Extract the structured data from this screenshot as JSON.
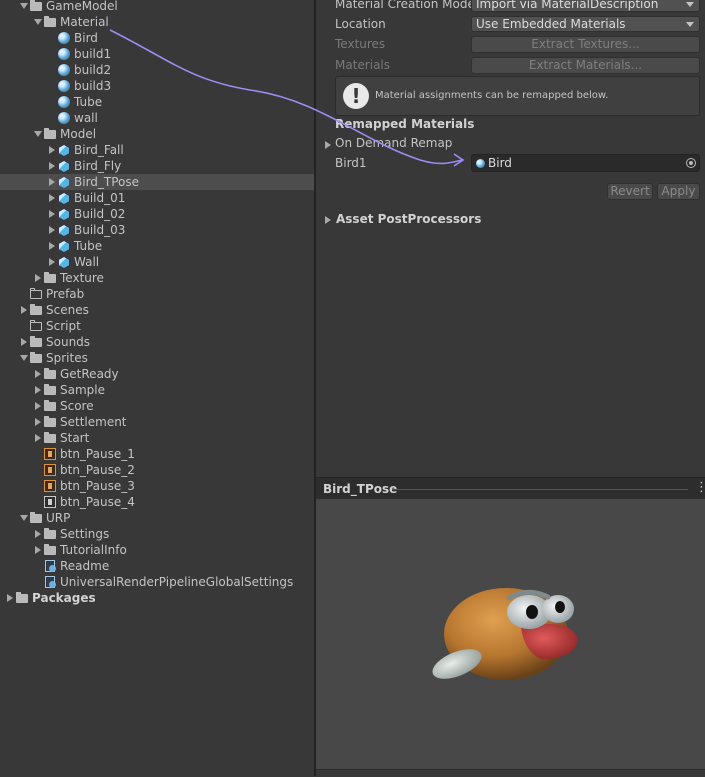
{
  "project_tree": [
    {
      "label": "GameModel",
      "indent": 1,
      "fold": "open",
      "icon": "folder-icon",
      "kind": "folder filled"
    },
    {
      "label": "Material",
      "indent": 2,
      "fold": "open",
      "icon": "folder-icon",
      "kind": "folder filled"
    },
    {
      "label": "Bird",
      "indent": 3,
      "fold": "",
      "icon": "material-icon",
      "kind": "sphere"
    },
    {
      "label": "build1",
      "indent": 3,
      "fold": "",
      "icon": "material-icon",
      "kind": "sphere"
    },
    {
      "label": "build2",
      "indent": 3,
      "fold": "",
      "icon": "material-icon",
      "kind": "sphere"
    },
    {
      "label": "build3",
      "indent": 3,
      "fold": "",
      "icon": "material-icon",
      "kind": "sphere"
    },
    {
      "label": "Tube",
      "indent": 3,
      "fold": "",
      "icon": "material-icon",
      "kind": "sphere"
    },
    {
      "label": "wall",
      "indent": 3,
      "fold": "",
      "icon": "material-icon",
      "kind": "sphere"
    },
    {
      "label": "Model",
      "indent": 2,
      "fold": "open",
      "icon": "folder-icon",
      "kind": "folder filled"
    },
    {
      "label": "Bird_Fall",
      "indent": 3,
      "fold": "closed",
      "icon": "model-icon",
      "kind": "cube"
    },
    {
      "label": "Bird_Fly",
      "indent": 3,
      "fold": "closed",
      "icon": "model-icon",
      "kind": "cube"
    },
    {
      "label": "Bird_TPose",
      "indent": 3,
      "fold": "closed",
      "icon": "model-icon",
      "kind": "cube",
      "selected": true
    },
    {
      "label": "Build_01",
      "indent": 3,
      "fold": "closed",
      "icon": "model-icon",
      "kind": "cube"
    },
    {
      "label": "Build_02",
      "indent": 3,
      "fold": "closed",
      "icon": "model-icon",
      "kind": "cube"
    },
    {
      "label": "Build_03",
      "indent": 3,
      "fold": "closed",
      "icon": "model-icon",
      "kind": "cube"
    },
    {
      "label": "Tube",
      "indent": 3,
      "fold": "closed",
      "icon": "model-icon",
      "kind": "cube"
    },
    {
      "label": "Wall",
      "indent": 3,
      "fold": "closed",
      "icon": "model-icon",
      "kind": "cube"
    },
    {
      "label": "Texture",
      "indent": 2,
      "fold": "closed",
      "icon": "folder-icon",
      "kind": "folder filled"
    },
    {
      "label": "Prefab",
      "indent": 1,
      "fold": "",
      "icon": "folder-icon",
      "kind": "folder"
    },
    {
      "label": "Scenes",
      "indent": 1,
      "fold": "closed",
      "icon": "folder-icon",
      "kind": "folder filled"
    },
    {
      "label": "Script",
      "indent": 1,
      "fold": "",
      "icon": "folder-icon",
      "kind": "folder"
    },
    {
      "label": "Sounds",
      "indent": 1,
      "fold": "closed",
      "icon": "folder-icon",
      "kind": "folder filled"
    },
    {
      "label": "Sprites",
      "indent": 1,
      "fold": "open",
      "icon": "folder-icon",
      "kind": "folder filled"
    },
    {
      "label": "GetReady",
      "indent": 2,
      "fold": "closed",
      "icon": "folder-icon",
      "kind": "folder filled"
    },
    {
      "label": "Sample",
      "indent": 2,
      "fold": "closed",
      "icon": "folder-icon",
      "kind": "folder filled"
    },
    {
      "label": "Score",
      "indent": 2,
      "fold": "closed",
      "icon": "folder-icon",
      "kind": "folder filled"
    },
    {
      "label": "Settlement",
      "indent": 2,
      "fold": "closed",
      "icon": "folder-icon",
      "kind": "folder filled"
    },
    {
      "label": "Start",
      "indent": 2,
      "fold": "closed",
      "icon": "folder-icon",
      "kind": "folder filled"
    },
    {
      "label": "btn_Pause_1",
      "indent": 2,
      "fold": "",
      "icon": "sprite-icon",
      "kind": "sprite"
    },
    {
      "label": "btn_Pause_2",
      "indent": 2,
      "fold": "",
      "icon": "sprite-icon",
      "kind": "sprite"
    },
    {
      "label": "btn_Pause_3",
      "indent": 2,
      "fold": "",
      "icon": "sprite-icon",
      "kind": "sprite"
    },
    {
      "label": "btn_Pause_4",
      "indent": 2,
      "fold": "",
      "icon": "sprite-icon",
      "kind": "sprite grey"
    },
    {
      "label": "URP",
      "indent": 1,
      "fold": "open",
      "icon": "folder-icon",
      "kind": "folder filled"
    },
    {
      "label": "Settings",
      "indent": 2,
      "fold": "closed",
      "icon": "folder-icon",
      "kind": "folder filled"
    },
    {
      "label": "TutorialInfo",
      "indent": 2,
      "fold": "closed",
      "icon": "folder-icon",
      "kind": "folder filled"
    },
    {
      "label": "Readme",
      "indent": 2,
      "fold": "",
      "icon": "readme-icon",
      "kind": "doc"
    },
    {
      "label": "UniversalRenderPipelineGlobalSettings",
      "indent": 2,
      "fold": "",
      "icon": "settings-asset-icon",
      "kind": "doc"
    },
    {
      "label": "Packages",
      "indent": 0,
      "fold": "closed",
      "icon": "folder-icon",
      "kind": "folder filled",
      "bold": true
    }
  ],
  "inspector": {
    "material_creation_mode_label": "Material Creation Mode",
    "material_creation_mode_value": "Import via MaterialDescription",
    "location_label": "Location",
    "location_value": "Use Embedded Materials",
    "textures_label": "Textures",
    "extract_textures_button": "Extract Textures...",
    "materials_label": "Materials",
    "extract_materials_button": "Extract Materials...",
    "help_message": "Material assignments can be remapped below.",
    "remapped_header": "Remapped Materials",
    "on_demand_remap": "On Demand Remap",
    "bird1_label": "Bird1",
    "bird1_value": "Bird",
    "revert_button": "Revert",
    "apply_button": "Apply",
    "asset_postprocessors": "Asset PostProcessors"
  },
  "preview": {
    "title": "Bird_TPose"
  },
  "colors": {
    "annotation_arrow": "#9b8cf0",
    "selection": "#4d4d4d"
  }
}
